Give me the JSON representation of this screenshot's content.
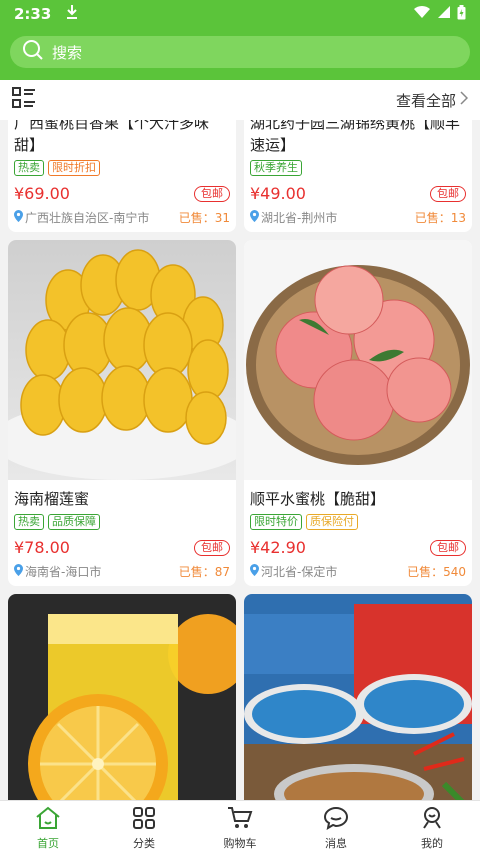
{
  "status": {
    "time": "2:33"
  },
  "search": {
    "placeholder": "搜索"
  },
  "subbar": {
    "view_all": "查看全部"
  },
  "products": [
    {
      "name": "广西蜜桃百香果【个大汁多味甜】",
      "tags": [
        {
          "text": "热卖",
          "color": "green"
        },
        {
          "text": "限时折扣",
          "color": "orange"
        }
      ],
      "price": "¥69.00",
      "shipping": "包邮",
      "location": "广西壮族自治区-南宁市",
      "sold": "已售：31"
    },
    {
      "name": "湖北药子园三湖锦绣黄桃【顺丰速运】",
      "tags": [
        {
          "text": "秋季养生",
          "color": "green"
        }
      ],
      "price": "¥49.00",
      "shipping": "包邮",
      "location": "湖北省-荆州市",
      "sold": "已售：13"
    },
    {
      "name": "海南榴莲蜜",
      "tags": [
        {
          "text": "热卖",
          "color": "green"
        },
        {
          "text": "品质保障",
          "color": "green"
        }
      ],
      "price": "¥78.00",
      "shipping": "包邮",
      "location": "海南省-海口市",
      "sold": "已售：87"
    },
    {
      "name": "顺平水蜜桃【脆甜】",
      "tags": [
        {
          "text": "限时特价",
          "color": "green"
        },
        {
          "text": "质保险付",
          "color": "yellow"
        }
      ],
      "price": "¥42.90",
      "shipping": "包邮",
      "location": "河北省-保定市",
      "sold": "已售：540"
    }
  ],
  "tabbar": [
    {
      "label": "首页",
      "icon": "home-icon",
      "active": true
    },
    {
      "label": "分类",
      "icon": "grid-icon",
      "active": false
    },
    {
      "label": "购物车",
      "icon": "cart-icon",
      "active": false
    },
    {
      "label": "消息",
      "icon": "message-icon",
      "active": false
    },
    {
      "label": "我的",
      "icon": "profile-icon",
      "active": false
    }
  ],
  "colors": {
    "brand": "#5bc43a",
    "price": "#e8302f"
  }
}
